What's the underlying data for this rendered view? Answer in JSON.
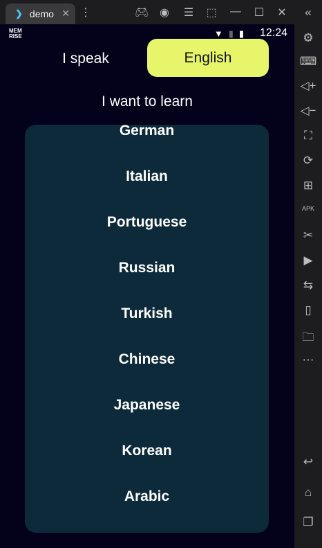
{
  "window": {
    "tab_title": "demo",
    "tab_icon": "flutter-icon",
    "toolbar_icons": [
      "gamepad-icon",
      "account-icon",
      "menu-icon",
      "resize-icon",
      "minimize-icon",
      "maximize-icon",
      "close-icon"
    ]
  },
  "status": {
    "logo": "MEM RISE",
    "time": "12:24"
  },
  "app": {
    "speak_label": "I speak",
    "speak_language": "English",
    "learn_label": "I want to learn",
    "languages": [
      "German",
      "Italian",
      "Portuguese",
      "Russian",
      "Turkish",
      "Chinese",
      "Japanese",
      "Korean",
      "Arabic"
    ]
  },
  "colors": {
    "accent": "#e6f56a",
    "panel": "#0c2a3a",
    "background": "#03021a"
  },
  "sidebar": {
    "icons": [
      "settings-icon",
      "keyboard-icon",
      "volume-up-icon",
      "volume-down-icon",
      "screenshot-icon",
      "rotate-icon",
      "add-window-icon",
      "apk-icon",
      "scissors-icon",
      "video-icon",
      "transfer-icon",
      "shake-icon",
      "folder-icon",
      "more-icon",
      "back-icon",
      "home-icon",
      "recents-icon"
    ]
  }
}
